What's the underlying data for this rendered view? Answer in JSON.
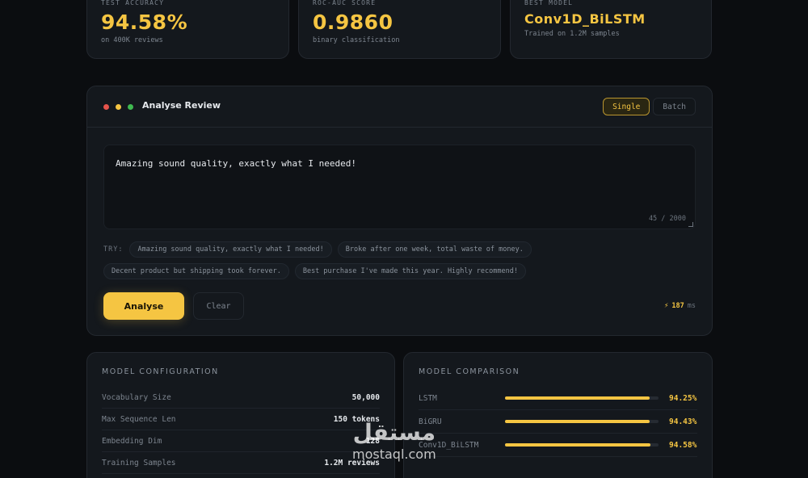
{
  "stats": [
    {
      "label": "TEST ACCURACY",
      "value": "94.58%",
      "sub": "on 400K reviews"
    },
    {
      "label": "ROC-AUC SCORE",
      "value": "0.9860",
      "sub": "binary classification"
    },
    {
      "label": "BEST MODEL",
      "value": "Conv1D_BiLSTM",
      "sub": "Trained on 1.2M samples"
    }
  ],
  "panel": {
    "title": "Analyse Review",
    "mode_single": "Single",
    "mode_batch": "Batch",
    "input_value": "Amazing sound quality, exactly what I needed!",
    "char_count": "45 / 2000",
    "try_label": "TRY:",
    "suggestions": [
      "Amazing sound quality, exactly what I needed!",
      "Broke after one week, total waste of money.",
      "Decent product but shipping took forever.",
      "Best purchase I've made this year. Highly recommend!"
    ],
    "analyse_label": "Analyse",
    "clear_label": "Clear",
    "latency_value": "187",
    "latency_unit": "ms"
  },
  "config": {
    "heading": "MODEL CONFIGURATION",
    "rows": [
      {
        "key": "Vocabulary Size",
        "value": "50,000"
      },
      {
        "key": "Max Sequence Len",
        "value": "150 tokens"
      },
      {
        "key": "Embedding Dim",
        "value": "128"
      },
      {
        "key": "Training Samples",
        "value": "1.2M reviews"
      }
    ]
  },
  "comparison": {
    "heading": "MODEL COMPARISON",
    "rows": [
      {
        "name": "LSTM",
        "value": "94.25%",
        "fraction": 0.9425
      },
      {
        "name": "BiGRU",
        "value": "94.43%",
        "fraction": 0.9443
      },
      {
        "name": "Conv1D_BiLSTM",
        "value": "94.58%",
        "fraction": 0.9458
      }
    ]
  },
  "watermark": {
    "arabic": "مستقل",
    "latin": "mostaql.com"
  },
  "colors": {
    "accent": "#f5c542",
    "background": "#0b0d10",
    "card": "#14181d"
  }
}
